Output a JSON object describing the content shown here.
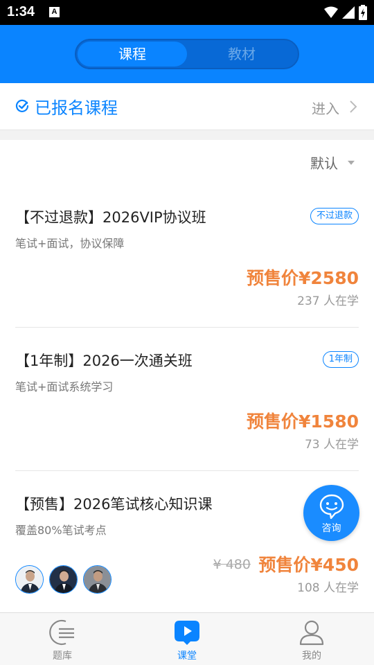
{
  "status_bar": {
    "time": "1:34",
    "notification_icon": "A"
  },
  "header": {
    "tabs": [
      {
        "label": "课程",
        "active": true
      },
      {
        "label": "教材",
        "active": false
      }
    ]
  },
  "enrolled": {
    "title": "已报名课程",
    "action": "进入"
  },
  "sort": {
    "label": "默认"
  },
  "courses": [
    {
      "title": "【不过退款】2026VIP协议班",
      "tag": "不过退款",
      "subtitle": "笔试+面试，协议保障",
      "price": "预售价¥2580",
      "students": "237 人在学"
    },
    {
      "title": "【1年制】2026一次通关班",
      "tag": "1年制",
      "subtitle": "笔试+面试系统学习",
      "price": "预售价¥1580",
      "students": "73 人在学"
    },
    {
      "title": "【预售】2026笔试核心知识课",
      "subtitle": "覆盖80%笔试考点",
      "original_price": "¥ 480",
      "price": "预售价¥450",
      "students": "108 人在学"
    }
  ],
  "consult": {
    "label": "咨询"
  },
  "tabbar": {
    "items": [
      {
        "label": "题库",
        "icon": "question-bank-icon",
        "active": false
      },
      {
        "label": "课堂",
        "icon": "classroom-play-icon",
        "active": true
      },
      {
        "label": "我的",
        "icon": "profile-icon",
        "active": false
      }
    ]
  },
  "colors": {
    "primary": "#0a84ff",
    "price": "#f0843c"
  }
}
